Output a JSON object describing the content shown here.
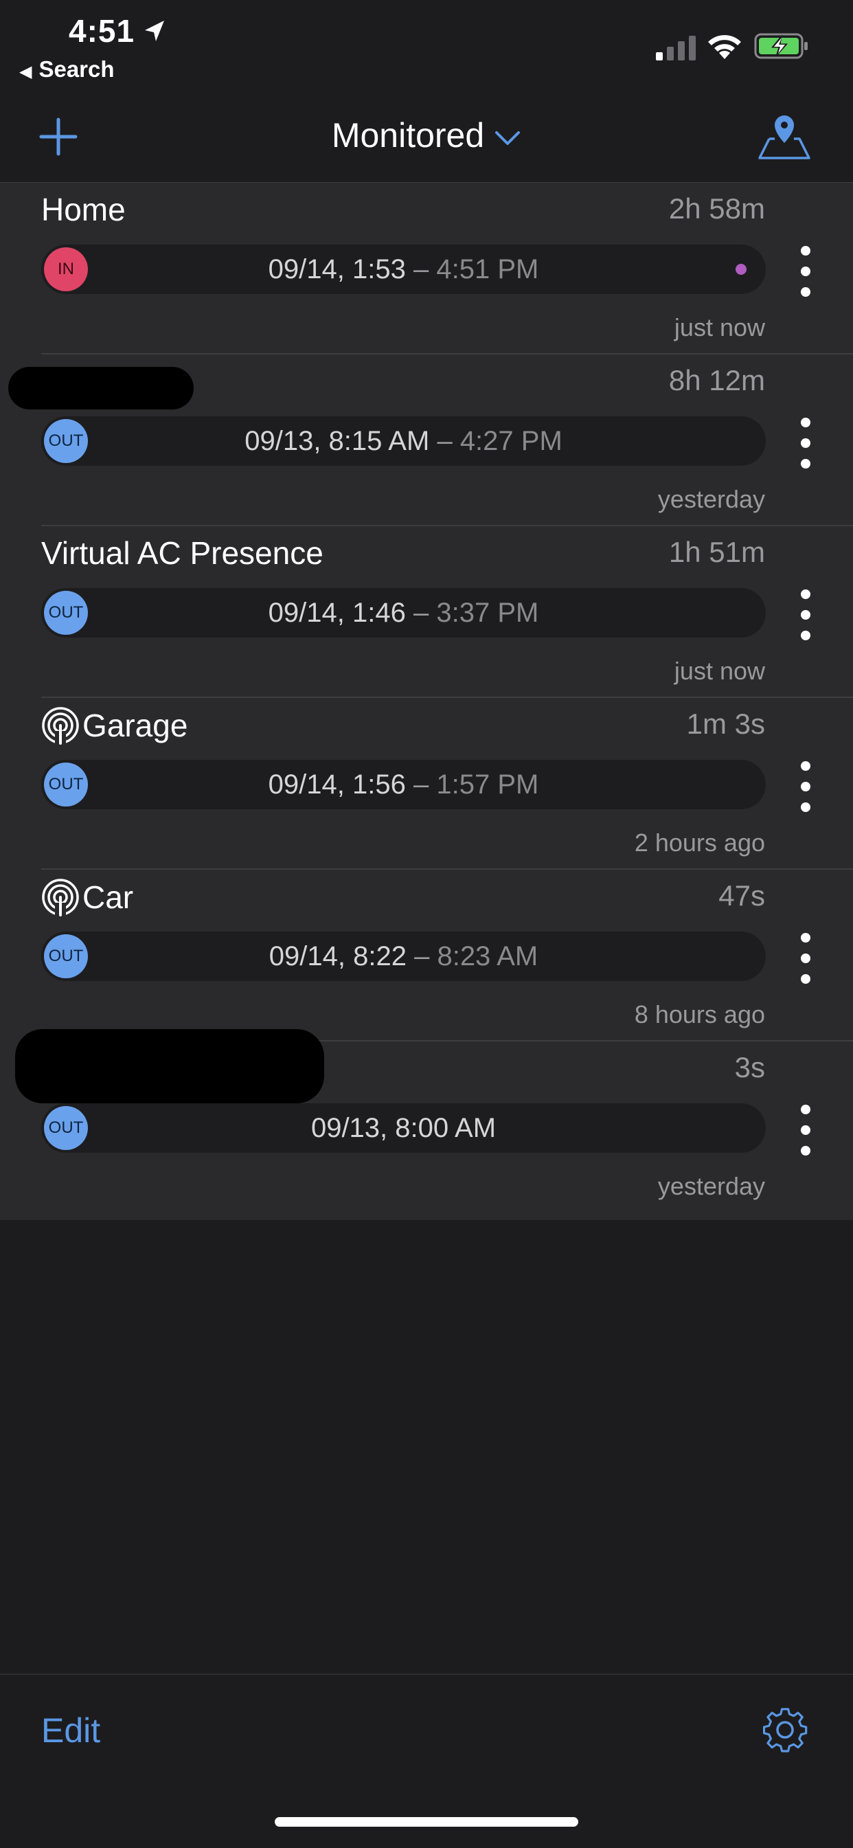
{
  "status_bar": {
    "time": "4:51",
    "back_label": "Search"
  },
  "nav": {
    "title": "Monitored"
  },
  "items": [
    {
      "name": "Home",
      "duration": "2h 58m",
      "badge": "IN",
      "start": "09/14, 1:53",
      "separator": "–",
      "end": "4:51 PM",
      "ago": "just now"
    },
    {
      "name": "",
      "duration": "8h 12m",
      "badge": "OUT",
      "start": "09/13, 8:15 AM",
      "separator": "–",
      "end": "4:27 PM",
      "ago": "yesterday"
    },
    {
      "name": "Virtual AC Presence",
      "duration": "1h 51m",
      "badge": "OUT",
      "start": "09/14, 1:46",
      "separator": "–",
      "end": "3:37 PM",
      "ago": "just now"
    },
    {
      "name": "Garage",
      "duration": "1m 3s",
      "badge": "OUT",
      "start": "09/14, 1:56",
      "separator": "–",
      "end": "1:57 PM",
      "ago": "2 hours ago"
    },
    {
      "name": "Car",
      "duration": "47s",
      "badge": "OUT",
      "start": "09/14, 8:22",
      "separator": "–",
      "end": "8:23 AM",
      "ago": "8 hours ago"
    },
    {
      "name": "",
      "duration": "3s",
      "badge": "OUT",
      "start": "09/13, 8:00 AM",
      "separator": "",
      "end": "",
      "ago": "yesterday"
    }
  ],
  "toolbar": {
    "edit_label": "Edit"
  },
  "colors": {
    "accent": "#5b97e4",
    "in_badge": "#e04466",
    "out_badge": "#6aa1ec",
    "background": "#1c1c1e",
    "row_background": "#2a2a2c",
    "active_dot": "#b05cc0"
  }
}
